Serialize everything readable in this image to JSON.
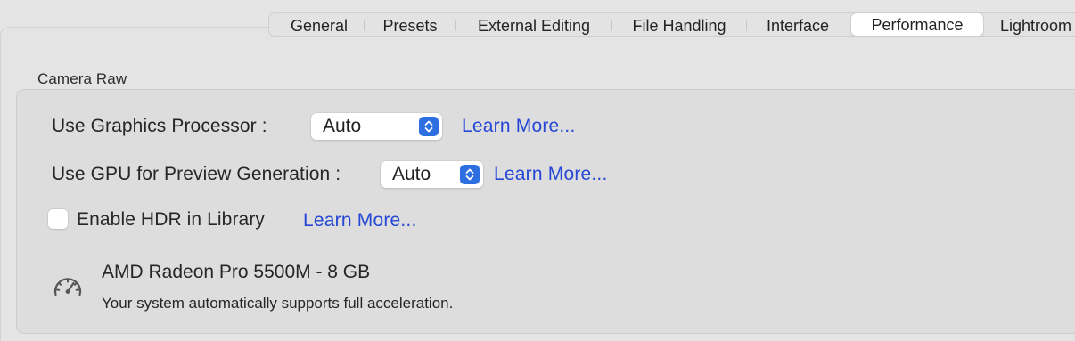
{
  "tabs": [
    {
      "label": "General"
    },
    {
      "label": "Presets"
    },
    {
      "label": "External Editing"
    },
    {
      "label": "File Handling"
    },
    {
      "label": "Interface"
    },
    {
      "label": "Performance",
      "selected": true
    },
    {
      "label": "Lightroom"
    }
  ],
  "camera_raw": {
    "group_title": "Camera Raw",
    "graphics_processor": {
      "label": "Use Graphics Processor :",
      "value": "Auto",
      "learn_more": "Learn More..."
    },
    "gpu_preview": {
      "label": "Use GPU for Preview Generation :",
      "value": "Auto",
      "learn_more": "Learn More..."
    },
    "hdr_library": {
      "label": "Enable HDR in Library",
      "checked": false,
      "learn_more": "Learn More..."
    },
    "gpu_info": {
      "icon": "gauge-icon",
      "name": "AMD Radeon Pro 5500M - 8 GB",
      "status": "Your system automatically supports full acceleration."
    }
  },
  "colors": {
    "accent": "#2d6fe0",
    "link": "#2547d6",
    "window_bg": "#e4e4e4"
  }
}
